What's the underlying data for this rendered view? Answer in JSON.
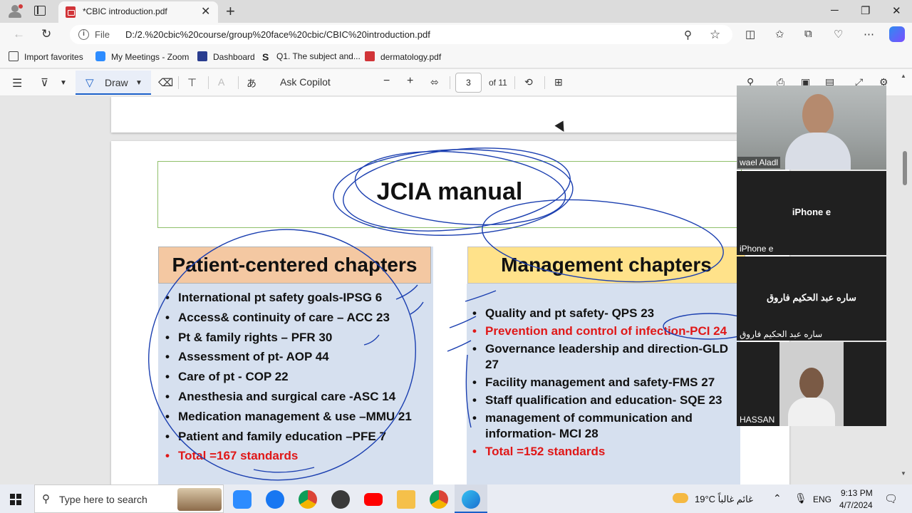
{
  "browser": {
    "tab_title": "*CBIC introduction.pdf",
    "file_label": "File",
    "url": "D:/2.%20cbic%20course/group%20face%20cbic/CBIC%20introduction.pdf",
    "favorites": [
      "Import favorites",
      "My Meetings - Zoom",
      "Dashboard",
      "Q1. The subject and...",
      "dermatology.pdf"
    ]
  },
  "pdf_toolbar": {
    "draw_label": "Draw",
    "ask_copilot": "Ask Copilot",
    "current_page": "3",
    "of_pages": "of 11"
  },
  "slide": {
    "title": "JCIA manual",
    "left_heading": "Patient-centered chapters",
    "left_items": [
      "International pt safety goals-IPSG  6",
      "Access& continuity of care – ACC 23",
      "Pt & family rights – PFR  30",
      "Assessment of pt- AOP  44",
      "Care of pt  - COP 22",
      "Anesthesia and  surgical care -ASC 14",
      "Medication management & use –MMU 21",
      "Patient and family education –PFE 7"
    ],
    "left_total": "Total =167 standards",
    "right_heading": "Management chapters",
    "right_items": [
      "Quality and pt safety- QPS   23",
      "Prevention and control of infection-PCI 24",
      "Governance leadership and direction-GLD 27",
      "Facility management and safety-FMS  27",
      "Staff qualification and education- SQE  23",
      " management of communication and information- MCI  28"
    ],
    "right_total": "Total =152 standards"
  },
  "participants": [
    {
      "name": "wael Aladl"
    },
    {
      "name": "iPhone e",
      "center": "iPhone e"
    },
    {
      "name": "ساره عبد الحكيم فاروق",
      "center": "ساره عبد الحكيم فاروق"
    },
    {
      "name": "HASSAN"
    }
  ],
  "taskbar": {
    "search_placeholder": "Type here to search",
    "weather": "19°C  غائم غالباً",
    "language": "ENG",
    "time": "9:13 PM",
    "date": "4/7/2024"
  },
  "colors": {
    "accent": "#1a60c9",
    "ink": "#1b3fb0",
    "red_text": "#e01818",
    "left_header": "#f4c8a2",
    "right_header": "#ffe28a",
    "list_bg": "#d6e0ef"
  }
}
